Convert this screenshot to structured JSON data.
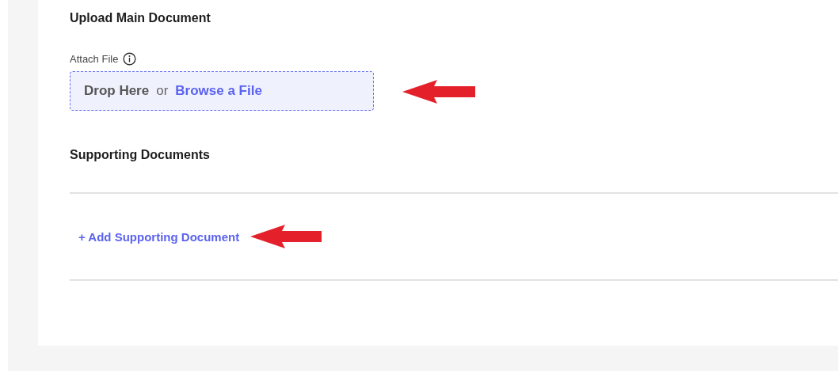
{
  "main_section": {
    "title": "Upload Main Document",
    "field_label": "Attach File",
    "dropzone": {
      "drop_text": "Drop Here",
      "or_text": "or",
      "browse_link": "Browse a File"
    }
  },
  "supporting_section": {
    "title": "Supporting Documents",
    "add_link": "+ Add Supporting Document"
  }
}
